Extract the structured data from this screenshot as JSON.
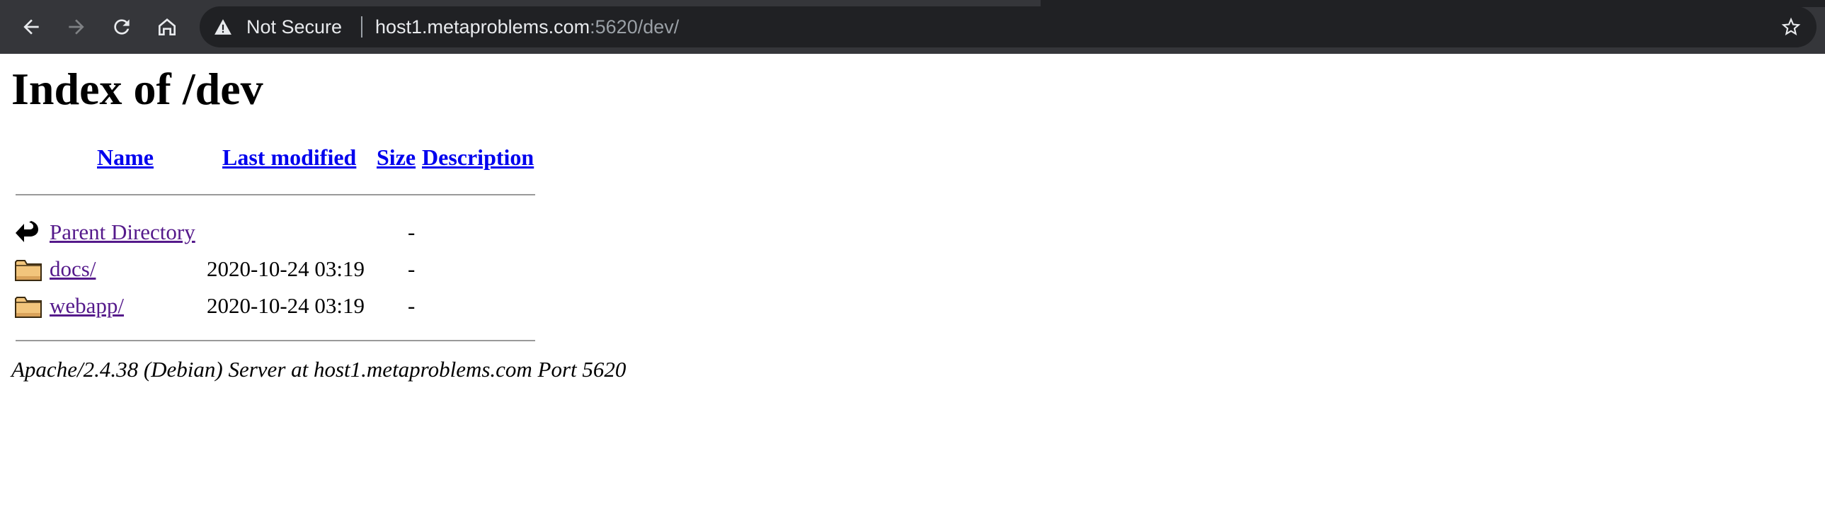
{
  "browser": {
    "security_label": "Not Secure",
    "url_host": "host1.metaproblems.com",
    "url_rest": ":5620/dev/"
  },
  "page": {
    "title": "Index of /dev",
    "columns": {
      "name": "Name",
      "last_modified": "Last modified",
      "size": "Size",
      "description": "Description"
    },
    "rows": [
      {
        "icon": "back-arrow-icon",
        "name": "Parent Directory",
        "modified": "",
        "size": "-"
      },
      {
        "icon": "folder-icon",
        "name": "docs/",
        "modified": "2020-10-24 03:19",
        "size": "-"
      },
      {
        "icon": "folder-icon",
        "name": "webapp/",
        "modified": "2020-10-24 03:19",
        "size": "-"
      }
    ],
    "footer": "Apache/2.4.38 (Debian) Server at host1.metaproblems.com Port 5620"
  },
  "colors": {
    "toolbar": "#35363a",
    "omnibox": "#202124",
    "link": "#0000ee",
    "visited_link": "#551a8b"
  }
}
